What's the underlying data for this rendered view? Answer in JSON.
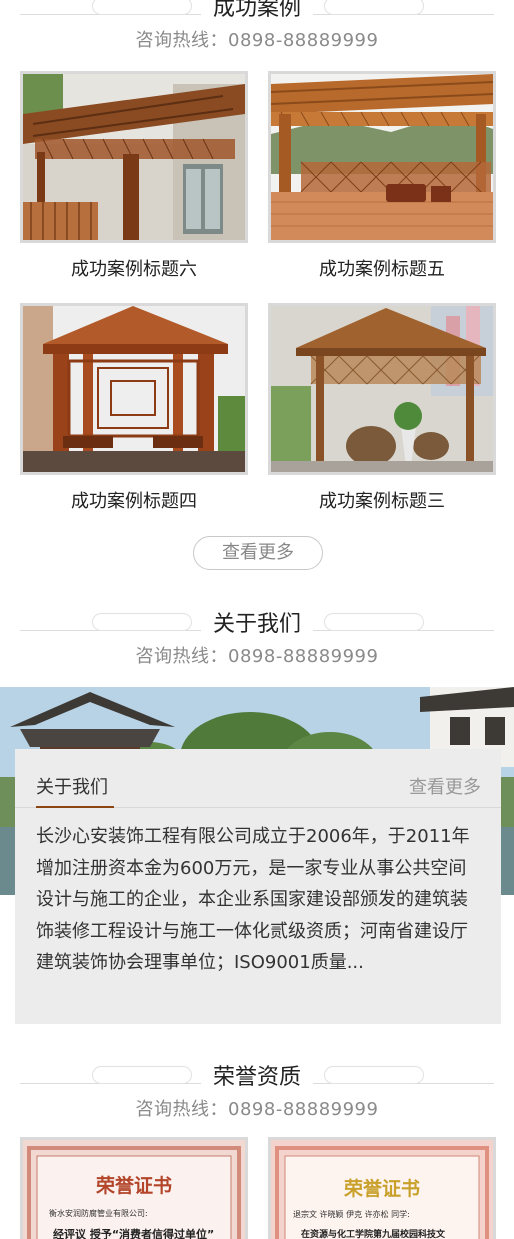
{
  "cases_section": {
    "title": "成功案例",
    "hotline": "咨询热线：0898-88889999",
    "items": [
      {
        "caption": "成功案例标题六"
      },
      {
        "caption": "成功案例标题五"
      },
      {
        "caption": "成功案例标题四"
      },
      {
        "caption": "成功案例标题三"
      }
    ],
    "more_label": "查看更多"
  },
  "about_section": {
    "title": "关于我们",
    "hotline": "咨询热线：0898-88889999",
    "card_title": "关于我们",
    "card_more": "查看更多",
    "text": "长沙心安装饰工程有限公司成立于2006年，于2011年增加注册资本金为600万元，是一家专业从事公共空间设计与施工的企业，本企业系国家建设部颁发的建筑装饰装修工程设计与施工一体化贰级资质；河南省建设厅建筑装饰协会理事单位；ISO9001质量..."
  },
  "honor_section": {
    "title": "荣誉资质",
    "hotline": "咨询热线：0898-88889999",
    "certs": [
      {
        "heading": "荣誉证书",
        "line1": "衡水安润防腐管业有限公司:",
        "line2": "经评议  授予“消费者信得过单位”"
      },
      {
        "heading": "荣誉证书",
        "line1": "退宗文 许晓颖 伊克 许亦松 同学:",
        "line2": "在资源与化工学院第九届校园科技文"
      }
    ]
  },
  "colors": {
    "accent_brown": "#8b4513",
    "card_bg": "#ececec",
    "hotline_grey": "#8a8a8a"
  }
}
